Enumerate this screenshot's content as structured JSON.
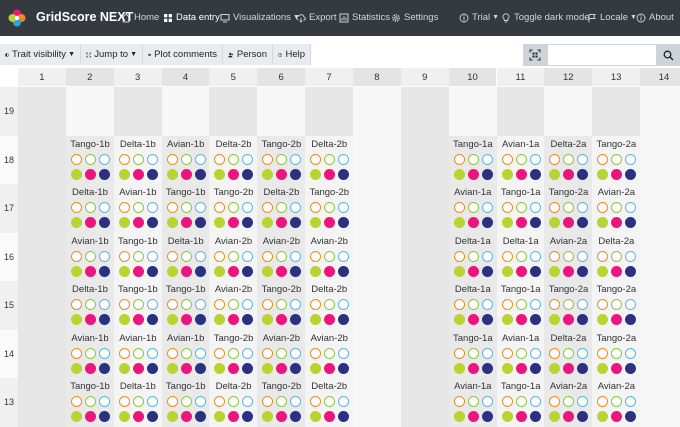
{
  "app": {
    "brand": "GridScore NEXT"
  },
  "nav": {
    "home": "Home",
    "data_entry": "Data entry",
    "visualizations": "Visualizations",
    "export": "Export",
    "statistics": "Statistics",
    "settings": "Settings",
    "trial": "Trial",
    "dark_mode": "Toggle dark mode",
    "locale": "Locale",
    "about": "About"
  },
  "toolbar": {
    "trait_visibility": "Trait visibility",
    "jump_to": "Jump to",
    "plot_comments": "Plot comments",
    "person": "Person",
    "help": "Help",
    "search_placeholder": ""
  },
  "grid": {
    "columns": [
      "1",
      "2",
      "3",
      "4",
      "5",
      "6",
      "7",
      "8",
      "9",
      "10",
      "11",
      "12",
      "13",
      "14"
    ],
    "rows": [
      {
        "label": "19",
        "cells": [
          "",
          "",
          "",
          "",
          "",
          "",
          "",
          "",
          "",
          "",
          "",
          "",
          "",
          ""
        ]
      },
      {
        "label": "18",
        "cells": [
          "",
          "Tango-1b",
          "Delta-1b",
          "Avian-1b",
          "Delta-2b",
          "Tango-2b",
          "Delta-2b",
          "",
          "",
          "Tango-1a",
          "Avian-1a",
          "Delta-2a",
          "Tango-2a",
          ""
        ]
      },
      {
        "label": "17",
        "cells": [
          "",
          "Delta-1b",
          "Avian-1b",
          "Tango-1b",
          "Tango-2b",
          "Delta-2b",
          "Tango-2b",
          "",
          "",
          "Avian-1a",
          "Tango-1a",
          "Tango-2a",
          "Avian-2a",
          ""
        ]
      },
      {
        "label": "16",
        "cells": [
          "",
          "Avian-1b",
          "Tango-1b",
          "Delta-1b",
          "Avian-2b",
          "Avian-2b",
          "Avian-2b",
          "",
          "",
          "Delta-1a",
          "Delta-1a",
          "Avian-2a",
          "Delta-2a",
          ""
        ]
      },
      {
        "label": "15",
        "cells": [
          "",
          "Delta-1b",
          "Tango-1b",
          "Tango-1b",
          "Avian-2b",
          "Tango-2b",
          "Delta-2b",
          "",
          "",
          "Delta-1a",
          "Tango-1a",
          "Tango-2a",
          "Tango-2a",
          ""
        ]
      },
      {
        "label": "14",
        "cells": [
          "",
          "Avian-1b",
          "Avian-1b",
          "Avian-1b",
          "Tango-2b",
          "Avian-2b",
          "Avian-2b",
          "",
          "",
          "Tango-1a",
          "Avian-1a",
          "Delta-2a",
          "Tango-2a",
          ""
        ]
      },
      {
        "label": "13",
        "cells": [
          "",
          "Tango-1b",
          "Delta-1b",
          "Tango-1b",
          "Delta-2b",
          "Tango-2b",
          "Delta-2b",
          "",
          "",
          "Avian-1a",
          "Tango-1a",
          "Avian-2a",
          "Avian-2a",
          ""
        ]
      }
    ]
  },
  "trait_colors": [
    "#b8d430",
    "#ed147b",
    "#2a3180"
  ],
  "outline_colors": [
    "#f08a20",
    "#8cc63f",
    "#5bb5e0"
  ],
  "colors": {
    "navbar": "#343a40",
    "stripe_dark": "#e9e9e9",
    "stripe_light": "#f4f4f4",
    "empty": "#e6e6e6"
  }
}
